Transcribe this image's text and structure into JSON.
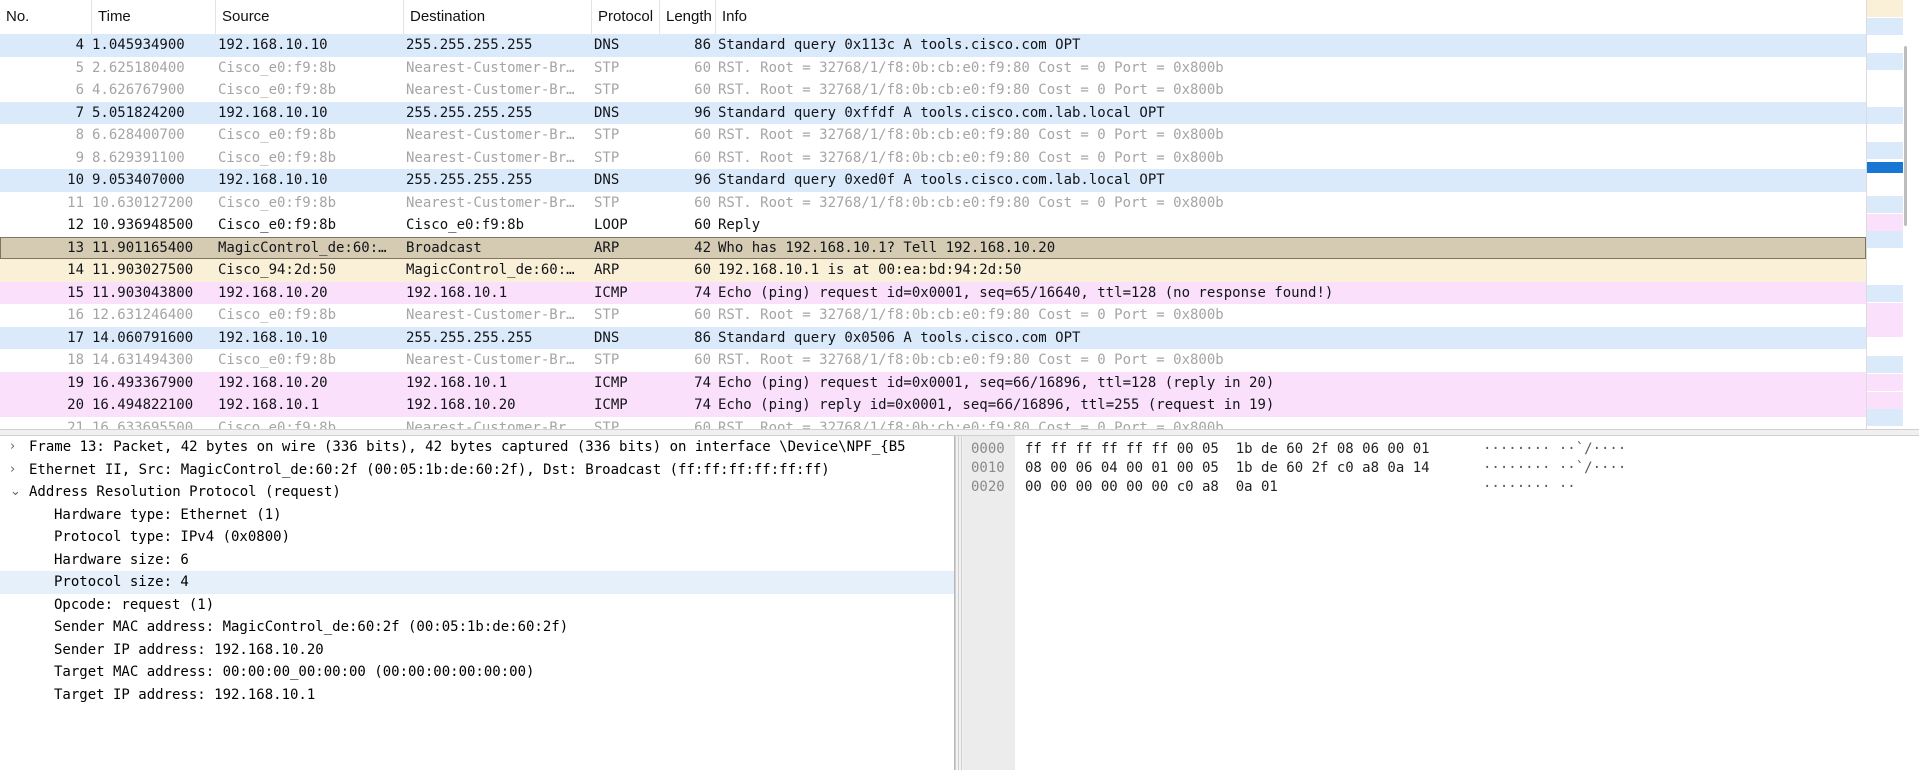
{
  "packet_list": {
    "columns": [
      "No.",
      "Time",
      "Source",
      "Destination",
      "Protocol",
      "Length",
      "Info"
    ],
    "rows": [
      {
        "no": "4",
        "time": "1.045934900",
        "src": "192.168.10.10",
        "dst": "255.255.255.255",
        "proto": "DNS",
        "len": "86",
        "info": "Standard query 0x113c A tools.cisco.com OPT",
        "kind": "dns"
      },
      {
        "no": "5",
        "time": "2.625180400",
        "src": "Cisco_e0:f9:8b",
        "dst": "Nearest-Customer-Br…",
        "proto": "STP",
        "len": "60",
        "info": "RST. Root = 32768/1/f8:0b:cb:e0:f9:80  Cost = 0  Port = 0x800b",
        "kind": "stp"
      },
      {
        "no": "6",
        "time": "4.626767900",
        "src": "Cisco_e0:f9:8b",
        "dst": "Nearest-Customer-Br…",
        "proto": "STP",
        "len": "60",
        "info": "RST. Root = 32768/1/f8:0b:cb:e0:f9:80  Cost = 0  Port = 0x800b",
        "kind": "stp"
      },
      {
        "no": "7",
        "time": "5.051824200",
        "src": "192.168.10.10",
        "dst": "255.255.255.255",
        "proto": "DNS",
        "len": "96",
        "info": "Standard query 0xffdf A tools.cisco.com.lab.local OPT",
        "kind": "dns"
      },
      {
        "no": "8",
        "time": "6.628400700",
        "src": "Cisco_e0:f9:8b",
        "dst": "Nearest-Customer-Br…",
        "proto": "STP",
        "len": "60",
        "info": "RST. Root = 32768/1/f8:0b:cb:e0:f9:80  Cost = 0  Port = 0x800b",
        "kind": "stp"
      },
      {
        "no": "9",
        "time": "8.629391100",
        "src": "Cisco_e0:f9:8b",
        "dst": "Nearest-Customer-Br…",
        "proto": "STP",
        "len": "60",
        "info": "RST. Root = 32768/1/f8:0b:cb:e0:f9:80  Cost = 0  Port = 0x800b",
        "kind": "stp"
      },
      {
        "no": "10",
        "time": "9.053407000",
        "src": "192.168.10.10",
        "dst": "255.255.255.255",
        "proto": "DNS",
        "len": "96",
        "info": "Standard query 0xed0f A tools.cisco.com.lab.local OPT",
        "kind": "dns"
      },
      {
        "no": "11",
        "time": "10.630127200",
        "src": "Cisco_e0:f9:8b",
        "dst": "Nearest-Customer-Br…",
        "proto": "STP",
        "len": "60",
        "info": "RST. Root = 32768/1/f8:0b:cb:e0:f9:80  Cost = 0  Port = 0x800b",
        "kind": "stp"
      },
      {
        "no": "12",
        "time": "10.936948500",
        "src": "Cisco_e0:f9:8b",
        "dst": "Cisco_e0:f9:8b",
        "proto": "LOOP",
        "len": "60",
        "info": "Reply",
        "kind": "loop"
      },
      {
        "no": "13",
        "time": "11.901165400",
        "src": "MagicControl_de:60:…",
        "dst": "Broadcast",
        "proto": "ARP",
        "len": "42",
        "info": "Who has 192.168.10.1? Tell 192.168.10.20",
        "kind": "arp",
        "selected": true
      },
      {
        "no": "14",
        "time": "11.903027500",
        "src": "Cisco_94:2d:50",
        "dst": "MagicControl_de:60:…",
        "proto": "ARP",
        "len": "60",
        "info": "192.168.10.1 is at 00:ea:bd:94:2d:50",
        "kind": "arp"
      },
      {
        "no": "15",
        "time": "11.903043800",
        "src": "192.168.10.20",
        "dst": "192.168.10.1",
        "proto": "ICMP",
        "len": "74",
        "info": "Echo (ping) request  id=0x0001, seq=65/16640, ttl=128 (no response found!)",
        "kind": "icmp"
      },
      {
        "no": "16",
        "time": "12.631246400",
        "src": "Cisco_e0:f9:8b",
        "dst": "Nearest-Customer-Br…",
        "proto": "STP",
        "len": "60",
        "info": "RST. Root = 32768/1/f8:0b:cb:e0:f9:80  Cost = 0  Port = 0x800b",
        "kind": "stp"
      },
      {
        "no": "17",
        "time": "14.060791600",
        "src": "192.168.10.10",
        "dst": "255.255.255.255",
        "proto": "DNS",
        "len": "86",
        "info": "Standard query 0x0506 A tools.cisco.com OPT",
        "kind": "dns"
      },
      {
        "no": "18",
        "time": "14.631494300",
        "src": "Cisco_e0:f9:8b",
        "dst": "Nearest-Customer-Br…",
        "proto": "STP",
        "len": "60",
        "info": "RST. Root = 32768/1/f8:0b:cb:e0:f9:80  Cost = 0  Port = 0x800b",
        "kind": "stp"
      },
      {
        "no": "19",
        "time": "16.493367900",
        "src": "192.168.10.20",
        "dst": "192.168.10.1",
        "proto": "ICMP",
        "len": "74",
        "info": "Echo (ping) request  id=0x0001, seq=66/16896, ttl=128 (reply in 20)",
        "kind": "icmp"
      },
      {
        "no": "20",
        "time": "16.494822100",
        "src": "192.168.10.1",
        "dst": "192.168.10.20",
        "proto": "ICMP",
        "len": "74",
        "info": "Echo (ping) reply    id=0x0001, seq=66/16896, ttl=255 (request in 19)",
        "kind": "icmp"
      },
      {
        "no": "21",
        "time": "16.633695500",
        "src": "Cisco_e0:f9:8b",
        "dst": "Nearest-Customer-Br…",
        "proto": "STP",
        "len": "60",
        "info": "RST. Root = 32768/1/f8:0b:cb:e0:f9:80  Cost = 0  Port = 0x800b",
        "kind": "stp"
      }
    ]
  },
  "colors": {
    "dns": "#dbeafb",
    "arp": "#faf0d7",
    "icmp": "#fbe0fb",
    "stp_text": "#a5a5a5",
    "selected": "#d5cab2",
    "minimap_selected": "#1976d2"
  },
  "details": {
    "rows": [
      {
        "text": "Frame 13: Packet, 42 bytes on wire (336 bits), 42 bytes captured (336 bits) on interface \\Device\\NPF_{B5",
        "arrow": "›",
        "level": 0
      },
      {
        "text": "Ethernet II, Src: MagicControl_de:60:2f (00:05:1b:de:60:2f), Dst: Broadcast (ff:ff:ff:ff:ff:ff)",
        "arrow": "›",
        "level": 0
      },
      {
        "text": "Address Resolution Protocol (request)",
        "arrow": "⌄",
        "level": 0
      },
      {
        "text": "Hardware type: Ethernet (1)",
        "arrow": "",
        "level": 1
      },
      {
        "text": "Protocol type: IPv4 (0x0800)",
        "arrow": "",
        "level": 1
      },
      {
        "text": "Hardware size: 6",
        "arrow": "",
        "level": 1
      },
      {
        "text": "Protocol size: 4",
        "arrow": "",
        "level": 1,
        "highlight": true
      },
      {
        "text": "Opcode: request (1)",
        "arrow": "",
        "level": 1
      },
      {
        "text": "Sender MAC address: MagicControl_de:60:2f (00:05:1b:de:60:2f)",
        "arrow": "",
        "level": 1
      },
      {
        "text": "Sender IP address: 192.168.10.20",
        "arrow": "",
        "level": 1
      },
      {
        "text": "Target MAC address: 00:00:00_00:00:00 (00:00:00:00:00:00)",
        "arrow": "",
        "level": 1
      },
      {
        "text": "Target IP address: 192.168.10.1",
        "arrow": "",
        "level": 1
      }
    ]
  },
  "bytes": {
    "rows": [
      {
        "offset": "0000",
        "hex": "ff ff ff ff ff ff 00 05  1b de 60 2f 08 06 00 01",
        "ascii": "········ ··`/····"
      },
      {
        "offset": "0010",
        "hex": "08 00 06 04 00 01 00 05  1b de 60 2f c0 a8 0a 14",
        "ascii": "········ ··`/····"
      },
      {
        "offset": "0020",
        "hex": "00 00 00 00 00 00 c0 a8  0a 01",
        "ascii": "········ ··"
      }
    ]
  }
}
